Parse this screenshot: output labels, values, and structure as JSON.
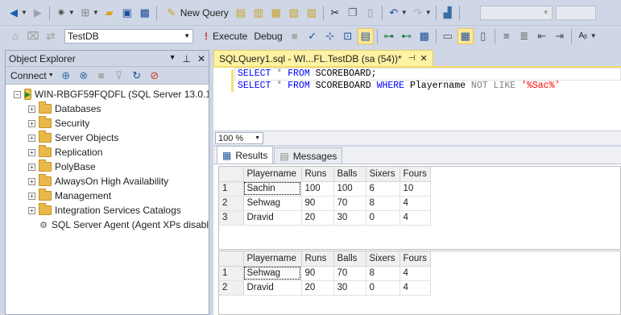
{
  "toolbar": {
    "new_query": "New Query",
    "database": "TestDB",
    "execute": "Execute",
    "debug": "Debug"
  },
  "object_explorer": {
    "title": "Object Explorer",
    "connect": "Connect",
    "server": "WIN-RBGF59FQDFL (SQL Server 13.0.16",
    "items": [
      "Databases",
      "Security",
      "Server Objects",
      "Replication",
      "PolyBase",
      "AlwaysOn High Availability",
      "Management",
      "Integration Services Catalogs"
    ],
    "agent": "SQL Server Agent (Agent XPs disabl"
  },
  "editor": {
    "tab_title": "SQLQuery1.sql - WI...FL.TestDB (sa (54))*",
    "line1": [
      "SELECT",
      "*",
      "FROM",
      "SCOREBOARD;"
    ],
    "line2": [
      "SELECT",
      "*",
      "FROM",
      "SCOREBOARD",
      "WHERE",
      "Playername",
      "NOT",
      "LIKE",
      "'%Sac%'"
    ]
  },
  "zoom": "100 %",
  "results": {
    "tabs": [
      "Results",
      "Messages"
    ],
    "columns": [
      "Playername",
      "Runs",
      "Balls",
      "Sixers",
      "Fours"
    ],
    "grid1": [
      [
        "1",
        "Sachin",
        "100",
        "100",
        "6",
        "10"
      ],
      [
        "2",
        "Sehwag",
        "90",
        "70",
        "8",
        "4"
      ],
      [
        "3",
        "Dravid",
        "20",
        "30",
        "0",
        "4"
      ]
    ],
    "grid2": [
      [
        "1",
        "Sehwag",
        "90",
        "70",
        "8",
        "4"
      ],
      [
        "2",
        "Dravid",
        "20",
        "30",
        "0",
        "4"
      ]
    ]
  }
}
